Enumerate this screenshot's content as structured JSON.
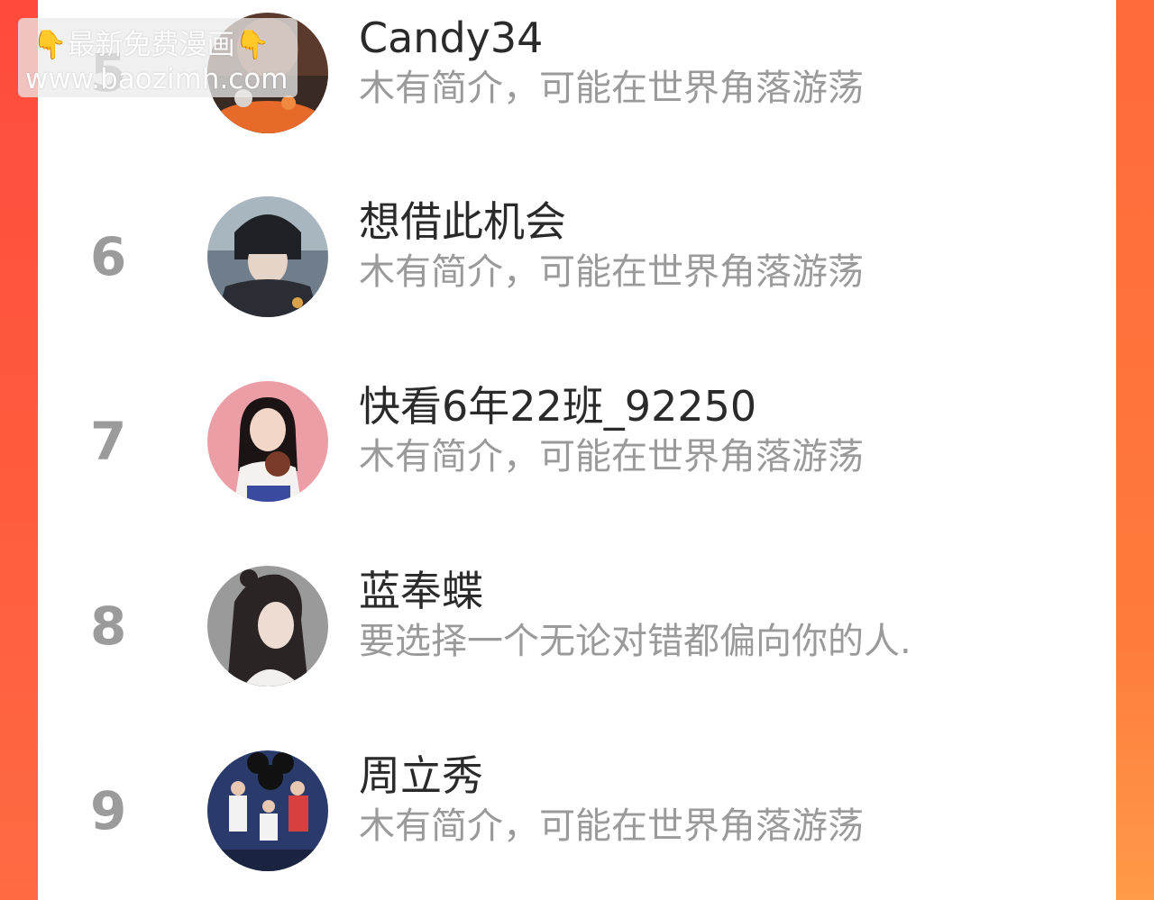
{
  "colors": {
    "frame_left": "#ff4a3c",
    "frame_right": "#ff7a3c",
    "rank_text": "#9b9b9b",
    "name_text": "#2a2a2a",
    "bio_text": "#9a9a9a"
  },
  "watermark": {
    "line1_text": "最新免费漫画",
    "hand_icon": "👇",
    "line2_text": "www.baozimh.com"
  },
  "leaderboard": {
    "rows": [
      {
        "rank": "5",
        "name": "Candy34",
        "bio": "木有简介，可能在世界角落游荡",
        "avatar_icon": "user-avatar-icon"
      },
      {
        "rank": "6",
        "name": "想借此机会",
        "bio": "木有简介，可能在世界角落游荡",
        "avatar_icon": "user-avatar-icon"
      },
      {
        "rank": "7",
        "name": "快看6年22班_92250",
        "bio": "木有简介，可能在世界角落游荡",
        "avatar_icon": "user-avatar-icon"
      },
      {
        "rank": "8",
        "name": "蓝奉蝶",
        "bio": "要选择一个无论对错都偏向你的人.",
        "avatar_icon": "user-avatar-icon"
      },
      {
        "rank": "9",
        "name": "周立秀",
        "bio": "木有简介，可能在世界角落游荡",
        "avatar_icon": "user-avatar-icon"
      }
    ]
  }
}
